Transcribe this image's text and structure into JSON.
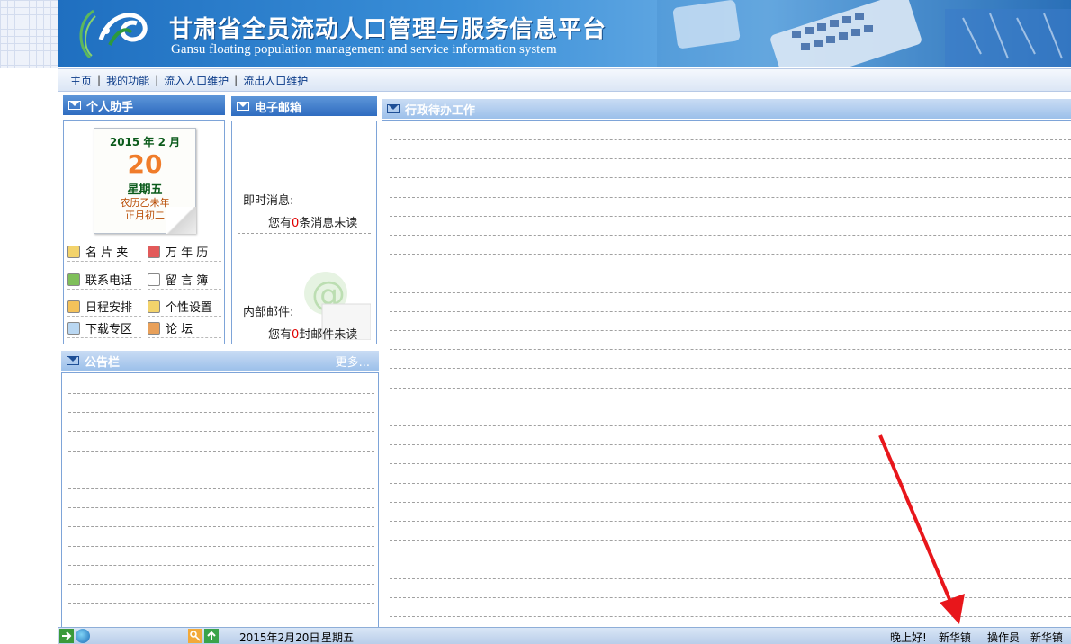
{
  "banner": {
    "title_cn": "甘肃省全员流动人口管理与服务信息平台",
    "title_en": "Gansu floating population management and service information system"
  },
  "nav": {
    "items": [
      "主页",
      "我的功能",
      "流入人口维护",
      "流出人口维护"
    ]
  },
  "assistant": {
    "title": "个人助手",
    "calendar": {
      "year_month": "2015 年 2 月",
      "day": "20",
      "weekday": "星期五",
      "lunar_year": "农历乙未年",
      "lunar_day": "正月初二"
    },
    "tools": [
      "名 片 夹",
      "万 年 历",
      "联系电话",
      "留 言 簿",
      "日程安排",
      "个性设置",
      "下载专区",
      "论 坛"
    ]
  },
  "mailbox": {
    "title": "电子邮箱",
    "instant_label": "即时消息:",
    "instant_prefix": "您有",
    "instant_count": "0",
    "instant_suffix": "条消息未读",
    "internal_label": "内部邮件:",
    "internal_prefix": "您有",
    "internal_count": "0",
    "internal_suffix": "封邮件未读"
  },
  "todo": {
    "title": "行政待办工作"
  },
  "bulletin": {
    "title": "公告栏",
    "more": "更多..."
  },
  "status": {
    "date": "2015年2月20日",
    "weekday": "星期五",
    "greeting": "晚上好!",
    "town": "新华镇",
    "role": "操作员",
    "town2": "新华镇"
  },
  "colors": {
    "panel_header": "#2f6cc0",
    "panel_header_light": "#9cc0ea",
    "nav_text": "#0a3a88",
    "annotation_arrow": "#e8161b"
  }
}
